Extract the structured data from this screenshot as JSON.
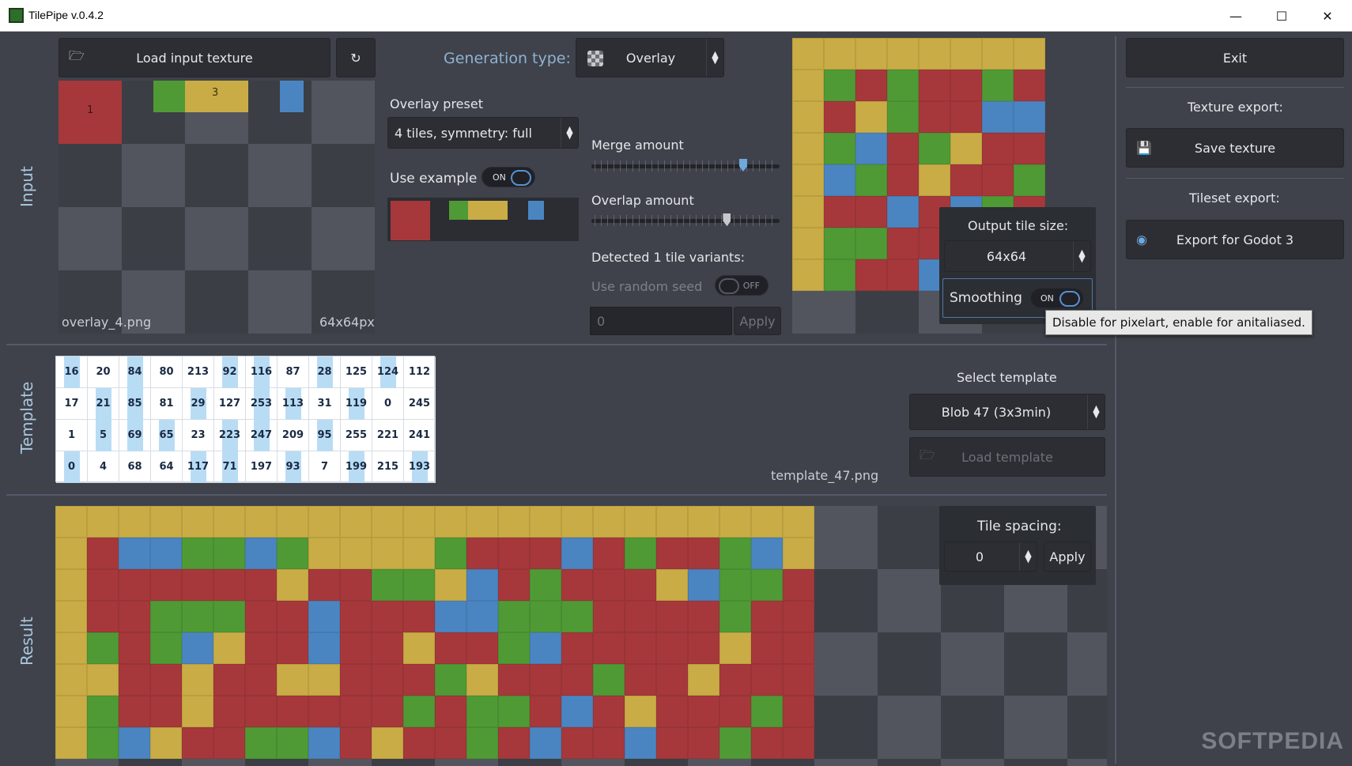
{
  "window": {
    "title": "TilePipe v.0.4.2",
    "minimize": "—",
    "maximize": "☐",
    "close": "✕"
  },
  "sections": {
    "input": "Input",
    "template": "Template",
    "result": "Result"
  },
  "input": {
    "load_button": "Load input texture",
    "reload_icon": "↻",
    "filename": "overlay_4.png",
    "size": "64x64px"
  },
  "generation": {
    "label": "Generation type:",
    "value": "Overlay",
    "overlay_preset_label": "Overlay preset",
    "overlay_preset_value": "4 tiles, symmetry: full",
    "use_example_label": "Use example",
    "use_example_state": "ON",
    "merge_label": "Merge amount",
    "merge_value": 0.82,
    "overlap_label": "Overlap amount",
    "overlap_value": 0.73,
    "detected": "Detected 1 tile variants:",
    "random_seed_label": "Use random seed",
    "random_seed_state": "OFF",
    "seed_value": "0",
    "seed_apply": "Apply"
  },
  "output": {
    "tile_size_label": "Output tile size:",
    "tile_size_value": "64x64",
    "smoothing_label": "Smoothing",
    "smoothing_state": "ON",
    "smoothing_tooltip": "Disable for pixelart, enable for anitaliased."
  },
  "export": {
    "exit": "Exit",
    "texture_export_label": "Texture export:",
    "save_texture": "Save texture",
    "tileset_export_label": "Tileset export:",
    "export_godot": "Export for Godot 3"
  },
  "template": {
    "select_label": "Select template",
    "select_value": "Blob 47 (3x3min)",
    "load_button": "Load template",
    "filename": "template_47.png",
    "rows": [
      [
        "16",
        "20",
        "84",
        "80",
        "213",
        "92",
        "116",
        "87",
        "28",
        "125",
        "124",
        "112"
      ],
      [
        "17",
        "21",
        "85",
        "81",
        "29",
        "127",
        "253",
        "113",
        "31",
        "119",
        "0",
        "245"
      ],
      [
        "1",
        "5",
        "69",
        "65",
        "23",
        "223",
        "247",
        "209",
        "95",
        "255",
        "221",
        "241"
      ],
      [
        "0",
        "4",
        "68",
        "64",
        "117",
        "71",
        "197",
        "93",
        "7",
        "199",
        "215",
        "193"
      ]
    ]
  },
  "result": {
    "tile_spacing_label": "Tile spacing:",
    "tile_spacing_value": "0",
    "apply": "Apply"
  },
  "icons": {
    "folder": "folder-icon",
    "save": "save-icon",
    "godot": "godot-icon",
    "overlay": "overlay-icon"
  },
  "colors": {
    "red": "#a6383b",
    "green": "#4f9a35",
    "yellow": "#c9ac45",
    "blue": "#4a85c1",
    "accent": "#5a8fd0"
  },
  "watermark": "SOFTPEDIA"
}
